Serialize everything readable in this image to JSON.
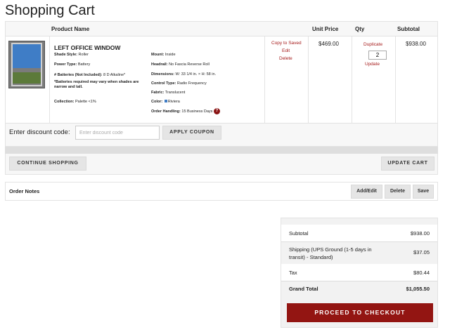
{
  "page": {
    "title": "Shopping Cart"
  },
  "cart": {
    "headers": {
      "product": "Product Name",
      "unit_price": "Unit Price",
      "qty": "Qty",
      "subtotal": "Subtotal"
    },
    "item": {
      "name": "LEFT OFFICE WINDOW",
      "specs_left": [
        {
          "label": "Shade Style:",
          "value": "Roller"
        },
        {
          "label": "Power Type:",
          "value": "Battery"
        },
        {
          "label": "# Batteries (Not Included):",
          "value": "8 D Alkaline*"
        },
        {
          "label": "*Batteries required may vary when shades are narrow and tall.",
          "value": ""
        },
        {
          "label": "Collection:",
          "value": "Palette <1%"
        }
      ],
      "specs_right": [
        {
          "label": "Mount:",
          "value": "Inside"
        },
        {
          "label": "Headrail:",
          "value": "No Fascia Reverse Roll"
        },
        {
          "label": "Dimensions:",
          "value": "W: 33 1/4 in. × H: 58 in."
        },
        {
          "label": "Control Type:",
          "value": "Radio Frequency"
        },
        {
          "label": "Fabric:",
          "value": "Translucent"
        },
        {
          "label": "Color:",
          "value": "Riviera",
          "swatch": "#3f7dc6"
        },
        {
          "label": "Order Handling:",
          "value": "15 Business Days"
        }
      ],
      "help_glyph": "?",
      "actions": {
        "copy": "Copy to Saved",
        "edit": "Edit",
        "delete": "Delete"
      },
      "unit_price": "$469.00",
      "qty_actions": {
        "duplicate": "Duplicate",
        "update": "Update"
      },
      "qty": "2",
      "subtotal": "$938.00"
    }
  },
  "discount": {
    "label": "Enter discount code:",
    "placeholder": "Enter discount code",
    "button": "APPLY COUPON"
  },
  "actions": {
    "continue": "CONTINUE SHOPPING",
    "update_cart": "UPDATE CART"
  },
  "notes": {
    "label": "Order Notes",
    "add_edit": "Add/Edit",
    "delete": "Delete",
    "save": "Save"
  },
  "summary": {
    "subtotal_label": "Subtotal",
    "subtotal": "$938.00",
    "shipping_label": "Shipping (UPS Ground (1-5 days in transit) - Standard)",
    "shipping": "$37.05",
    "tax_label": "Tax",
    "tax": "$80.44",
    "grand_label": "Grand Total",
    "grand": "$1,055.50",
    "checkout": "PROCEED TO CHECKOUT"
  },
  "colors": {
    "accent": "#931512",
    "link": "#a61c1c",
    "swatch": "#3f7dc6"
  }
}
